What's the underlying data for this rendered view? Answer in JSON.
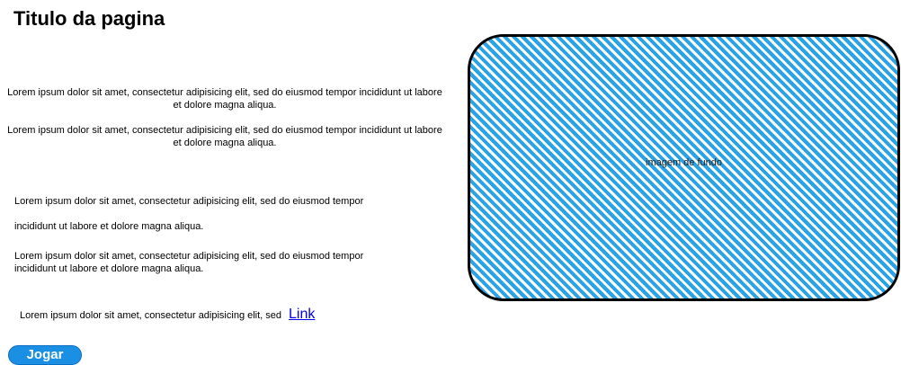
{
  "page": {
    "title": "Titulo da pagina"
  },
  "content": {
    "paragraphs_centered": [
      "Lorem ipsum dolor sit amet, consectetur adipisicing elit, sed do eiusmod tempor incididunt ut labore et dolore magna aliqua.",
      "Lorem ipsum dolor sit amet, consectetur adipisicing elit, sed do eiusmod tempor incididunt ut labore et dolore magna aliqua."
    ],
    "paragraph_split": {
      "line1": "Lorem ipsum dolor sit amet, consectetur adipisicing elit, sed do eiusmod tempor",
      "line2": "incididunt ut labore et dolore magna aliqua."
    },
    "paragraph_left": "Lorem ipsum dolor sit amet, consectetur adipisicing elit, sed do eiusmod tempor incididunt ut labore et dolore magna aliqua.",
    "link_row": {
      "text": "Lorem ipsum dolor sit amet, consectetur adipisicing elit, sed",
      "link_label": "Link"
    }
  },
  "actions": {
    "play_label": "Jogar"
  },
  "image": {
    "label": "imagem de fundo",
    "hatch_color": "#2aa3e6",
    "border_color": "#000000"
  },
  "colors": {
    "button_bg": "#1a8fe3",
    "button_text": "#ffffff",
    "link": "#0000ee"
  }
}
